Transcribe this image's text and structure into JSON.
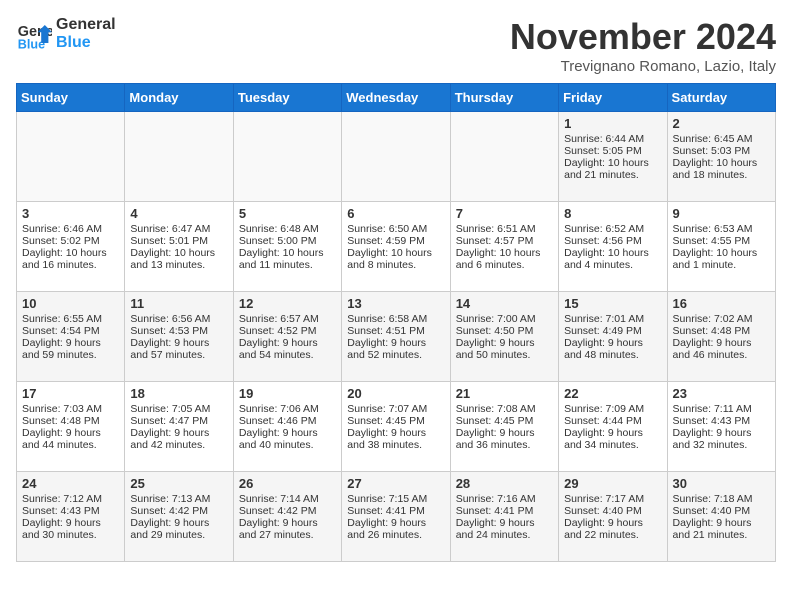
{
  "header": {
    "logo_line1": "General",
    "logo_line2": "Blue",
    "month": "November 2024",
    "location": "Trevignano Romano, Lazio, Italy"
  },
  "weekdays": [
    "Sunday",
    "Monday",
    "Tuesday",
    "Wednesday",
    "Thursday",
    "Friday",
    "Saturday"
  ],
  "weeks": [
    [
      {
        "day": "",
        "text": ""
      },
      {
        "day": "",
        "text": ""
      },
      {
        "day": "",
        "text": ""
      },
      {
        "day": "",
        "text": ""
      },
      {
        "day": "",
        "text": ""
      },
      {
        "day": "1",
        "text": "Sunrise: 6:44 AM\nSunset: 5:05 PM\nDaylight: 10 hours\nand 21 minutes."
      },
      {
        "day": "2",
        "text": "Sunrise: 6:45 AM\nSunset: 5:03 PM\nDaylight: 10 hours\nand 18 minutes."
      }
    ],
    [
      {
        "day": "3",
        "text": "Sunrise: 6:46 AM\nSunset: 5:02 PM\nDaylight: 10 hours\nand 16 minutes."
      },
      {
        "day": "4",
        "text": "Sunrise: 6:47 AM\nSunset: 5:01 PM\nDaylight: 10 hours\nand 13 minutes."
      },
      {
        "day": "5",
        "text": "Sunrise: 6:48 AM\nSunset: 5:00 PM\nDaylight: 10 hours\nand 11 minutes."
      },
      {
        "day": "6",
        "text": "Sunrise: 6:50 AM\nSunset: 4:59 PM\nDaylight: 10 hours\nand 8 minutes."
      },
      {
        "day": "7",
        "text": "Sunrise: 6:51 AM\nSunset: 4:57 PM\nDaylight: 10 hours\nand 6 minutes."
      },
      {
        "day": "8",
        "text": "Sunrise: 6:52 AM\nSunset: 4:56 PM\nDaylight: 10 hours\nand 4 minutes."
      },
      {
        "day": "9",
        "text": "Sunrise: 6:53 AM\nSunset: 4:55 PM\nDaylight: 10 hours\nand 1 minute."
      }
    ],
    [
      {
        "day": "10",
        "text": "Sunrise: 6:55 AM\nSunset: 4:54 PM\nDaylight: 9 hours\nand 59 minutes."
      },
      {
        "day": "11",
        "text": "Sunrise: 6:56 AM\nSunset: 4:53 PM\nDaylight: 9 hours\nand 57 minutes."
      },
      {
        "day": "12",
        "text": "Sunrise: 6:57 AM\nSunset: 4:52 PM\nDaylight: 9 hours\nand 54 minutes."
      },
      {
        "day": "13",
        "text": "Sunrise: 6:58 AM\nSunset: 4:51 PM\nDaylight: 9 hours\nand 52 minutes."
      },
      {
        "day": "14",
        "text": "Sunrise: 7:00 AM\nSunset: 4:50 PM\nDaylight: 9 hours\nand 50 minutes."
      },
      {
        "day": "15",
        "text": "Sunrise: 7:01 AM\nSunset: 4:49 PM\nDaylight: 9 hours\nand 48 minutes."
      },
      {
        "day": "16",
        "text": "Sunrise: 7:02 AM\nSunset: 4:48 PM\nDaylight: 9 hours\nand 46 minutes."
      }
    ],
    [
      {
        "day": "17",
        "text": "Sunrise: 7:03 AM\nSunset: 4:48 PM\nDaylight: 9 hours\nand 44 minutes."
      },
      {
        "day": "18",
        "text": "Sunrise: 7:05 AM\nSunset: 4:47 PM\nDaylight: 9 hours\nand 42 minutes."
      },
      {
        "day": "19",
        "text": "Sunrise: 7:06 AM\nSunset: 4:46 PM\nDaylight: 9 hours\nand 40 minutes."
      },
      {
        "day": "20",
        "text": "Sunrise: 7:07 AM\nSunset: 4:45 PM\nDaylight: 9 hours\nand 38 minutes."
      },
      {
        "day": "21",
        "text": "Sunrise: 7:08 AM\nSunset: 4:45 PM\nDaylight: 9 hours\nand 36 minutes."
      },
      {
        "day": "22",
        "text": "Sunrise: 7:09 AM\nSunset: 4:44 PM\nDaylight: 9 hours\nand 34 minutes."
      },
      {
        "day": "23",
        "text": "Sunrise: 7:11 AM\nSunset: 4:43 PM\nDaylight: 9 hours\nand 32 minutes."
      }
    ],
    [
      {
        "day": "24",
        "text": "Sunrise: 7:12 AM\nSunset: 4:43 PM\nDaylight: 9 hours\nand 30 minutes."
      },
      {
        "day": "25",
        "text": "Sunrise: 7:13 AM\nSunset: 4:42 PM\nDaylight: 9 hours\nand 29 minutes."
      },
      {
        "day": "26",
        "text": "Sunrise: 7:14 AM\nSunset: 4:42 PM\nDaylight: 9 hours\nand 27 minutes."
      },
      {
        "day": "27",
        "text": "Sunrise: 7:15 AM\nSunset: 4:41 PM\nDaylight: 9 hours\nand 26 minutes."
      },
      {
        "day": "28",
        "text": "Sunrise: 7:16 AM\nSunset: 4:41 PM\nDaylight: 9 hours\nand 24 minutes."
      },
      {
        "day": "29",
        "text": "Sunrise: 7:17 AM\nSunset: 4:40 PM\nDaylight: 9 hours\nand 22 minutes."
      },
      {
        "day": "30",
        "text": "Sunrise: 7:18 AM\nSunset: 4:40 PM\nDaylight: 9 hours\nand 21 minutes."
      }
    ]
  ]
}
